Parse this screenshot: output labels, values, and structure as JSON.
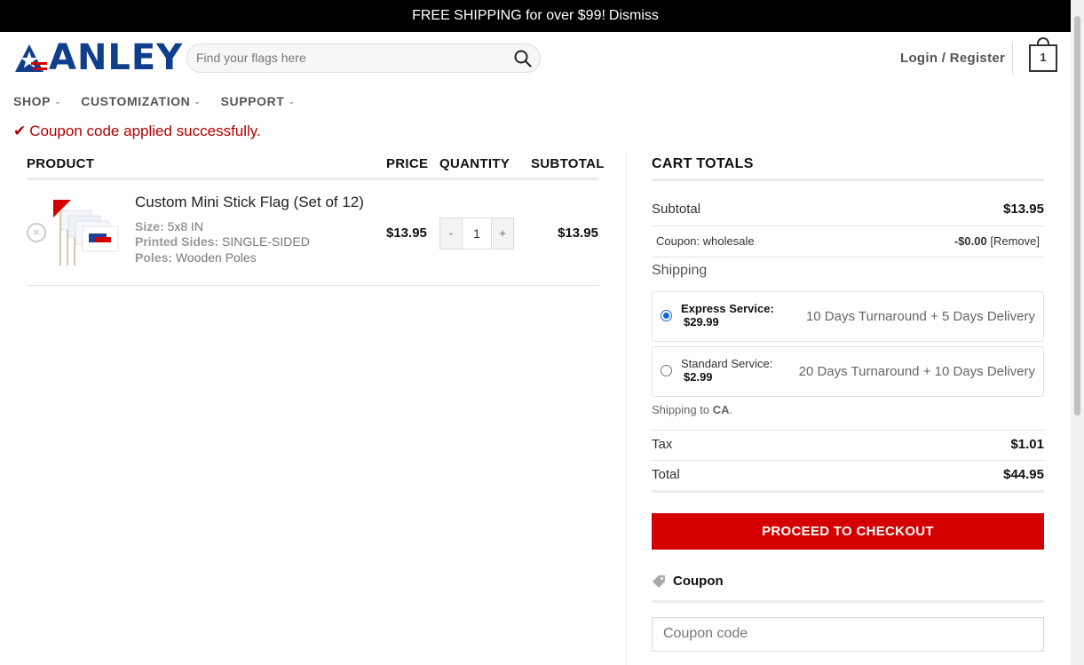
{
  "topbar": {
    "text": "FREE SHIPPING for over $99!",
    "dismiss": "Dismiss"
  },
  "brand": {
    "logo_text": "ANLEY",
    "colors": {
      "navy": "#0f3f8c",
      "red": "#d40000"
    }
  },
  "search": {
    "placeholder": "Find your flags here",
    "icon": "search-icon"
  },
  "header": {
    "login_label": "Login / Register",
    "cart_count": "1"
  },
  "nav": {
    "items": [
      {
        "label": "SHOP"
      },
      {
        "label": "CUSTOMIZATION"
      },
      {
        "label": "SUPPORT"
      }
    ]
  },
  "notice": {
    "text": "Coupon code applied successfully."
  },
  "cart": {
    "headers": {
      "product": "PRODUCT",
      "price": "PRICE",
      "quantity": "QUANTITY",
      "subtotal": "SUBTOTAL"
    },
    "items": [
      {
        "name": "Custom Mini Stick Flag (Set of 12)",
        "size_label": "Size:",
        "size": "5x8 IN",
        "sides_label": "Printed Sides:",
        "sides": "SINGLE-SIDED",
        "poles_label": "Poles:",
        "poles": "Wooden Poles",
        "price": "$13.95",
        "qty_minus": "-",
        "quantity": "1",
        "qty_plus": "+",
        "subtotal": "$13.95"
      }
    ]
  },
  "totals": {
    "heading": "CART TOTALS",
    "subtotal_label": "Subtotal",
    "subtotal": "$13.95",
    "coupon_label": "Coupon: wholesale",
    "coupon_value": "-$0.00",
    "coupon_remove": "[Remove]",
    "shipping_label": "Shipping",
    "shipping_options": [
      {
        "name": "Express Service:",
        "price": "$29.99",
        "desc": "10 Days Turnaround + 5 Days Delivery",
        "selected": true
      },
      {
        "name": "Standard Service:",
        "price": "$2.99",
        "desc": "20 Days Turnaround + 10 Days Delivery",
        "selected": false
      }
    ],
    "shipping_to_prefix": "Shipping to",
    "shipping_to": "CA",
    "tax_label": "Tax",
    "tax": "$1.01",
    "total_label": "Total",
    "total": "$44.95",
    "checkout_label": "PROCEED TO CHECKOUT",
    "coupon_heading": "Coupon",
    "coupon_placeholder": "Coupon code"
  }
}
